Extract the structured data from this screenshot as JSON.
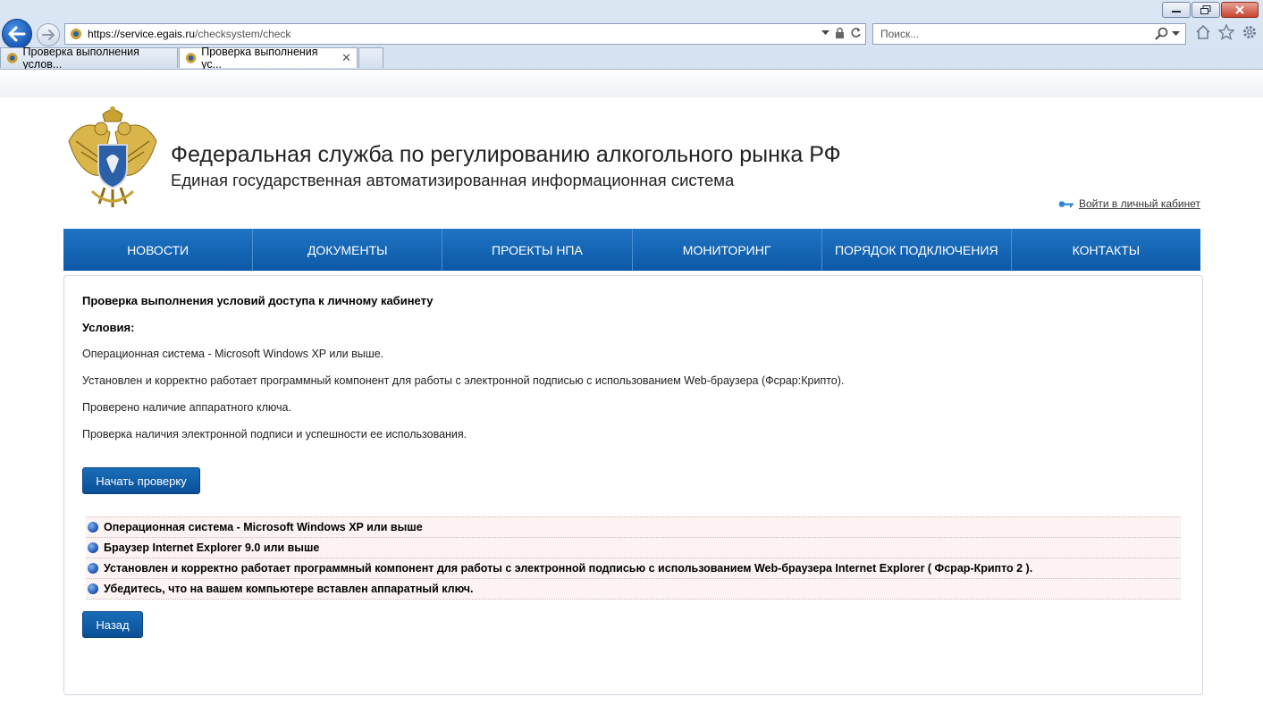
{
  "browser": {
    "url_host": "https://service.egais.ru",
    "url_path": "/checksystem/check",
    "search_placeholder": "Поиск...",
    "tabs": [
      {
        "label": "Проверка выполнения услов..."
      },
      {
        "label": "Проверка выполнения ус..."
      }
    ],
    "tab_close": "✕"
  },
  "header": {
    "title": "Федеральная служба по регулированию алкогольного рынка РФ",
    "subtitle": "Единая государственная автоматизированная информационная система",
    "login_link": "Войти в личный кабинет"
  },
  "nav": {
    "items": [
      {
        "label": "НОВОСТИ"
      },
      {
        "label": "ДОКУМЕНТЫ"
      },
      {
        "label": "ПРОЕКТЫ НПА"
      },
      {
        "label": "МОНИТОРИНГ"
      },
      {
        "label": "ПОРЯДОК ПОДКЛЮЧЕНИЯ"
      },
      {
        "label": "КОНТАКТЫ"
      }
    ]
  },
  "content": {
    "title": "Проверка выполнения условий доступа к личному кабинету",
    "conditions_label": "Условия:",
    "conditions": [
      "Операционная система - Microsoft Windows XP или выше.",
      "Установлен и корректно работает программный компонент для работы с электронной подписью с использованием Web-браузера (Фсрар:Крипто).",
      "Проверено наличие аппаратного ключа.",
      "Проверка наличия электронной подписи и успешности ее использования."
    ],
    "start_button": "Начать проверку",
    "checks": [
      "Операционная система - Microsoft Windows XP или выше",
      "Браузер Internet Explorer 9.0 или выше",
      "Установлен и корректно работает программный компонент для работы с электронной подписью с использованием Web-браузера Internet Explorer ( Фсрар-Крипто 2 ).",
      "Убедитесь, что на вашем компьютере вставлен аппаратный ключ."
    ],
    "back_button": "Назад"
  },
  "colors": {
    "nav_bg": "#0c58a6",
    "button_bg": "#0a4f96",
    "check_row_bg": "#fdf3f3"
  }
}
